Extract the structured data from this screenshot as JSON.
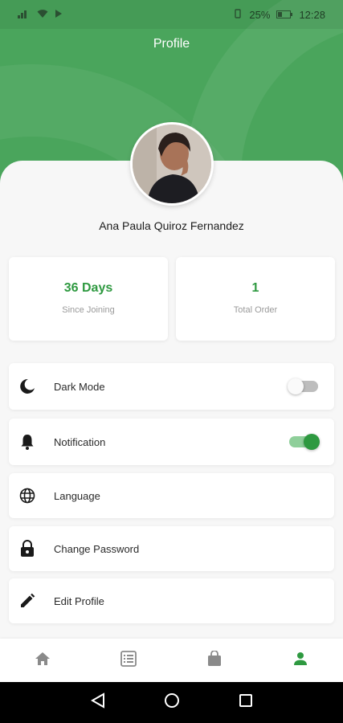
{
  "status_bar": {
    "battery": "25%",
    "time": "12:28"
  },
  "header": {
    "title": "Profile"
  },
  "profile": {
    "name": "Ana Paula Quiroz Fernandez"
  },
  "stats": [
    {
      "value": "36 Days",
      "label": "Since Joining"
    },
    {
      "value": "1",
      "label": "Total Order"
    }
  ],
  "settings": [
    {
      "label": "Dark Mode",
      "icon": "moon-icon",
      "toggle": "off"
    },
    {
      "label": "Notification",
      "icon": "bell-icon",
      "toggle": "on"
    },
    {
      "label": "Language",
      "icon": "globe-icon"
    },
    {
      "label": "Change Password",
      "icon": "lock-icon"
    },
    {
      "label": "Edit Profile",
      "icon": "pencil-icon"
    }
  ],
  "bottom_nav": [
    "home-icon",
    "list-icon",
    "shopping-bag-icon",
    "person-icon"
  ],
  "colors": {
    "accent": "#2e9940",
    "header": "#4aa55c",
    "inactive": "#8a8a8a"
  }
}
